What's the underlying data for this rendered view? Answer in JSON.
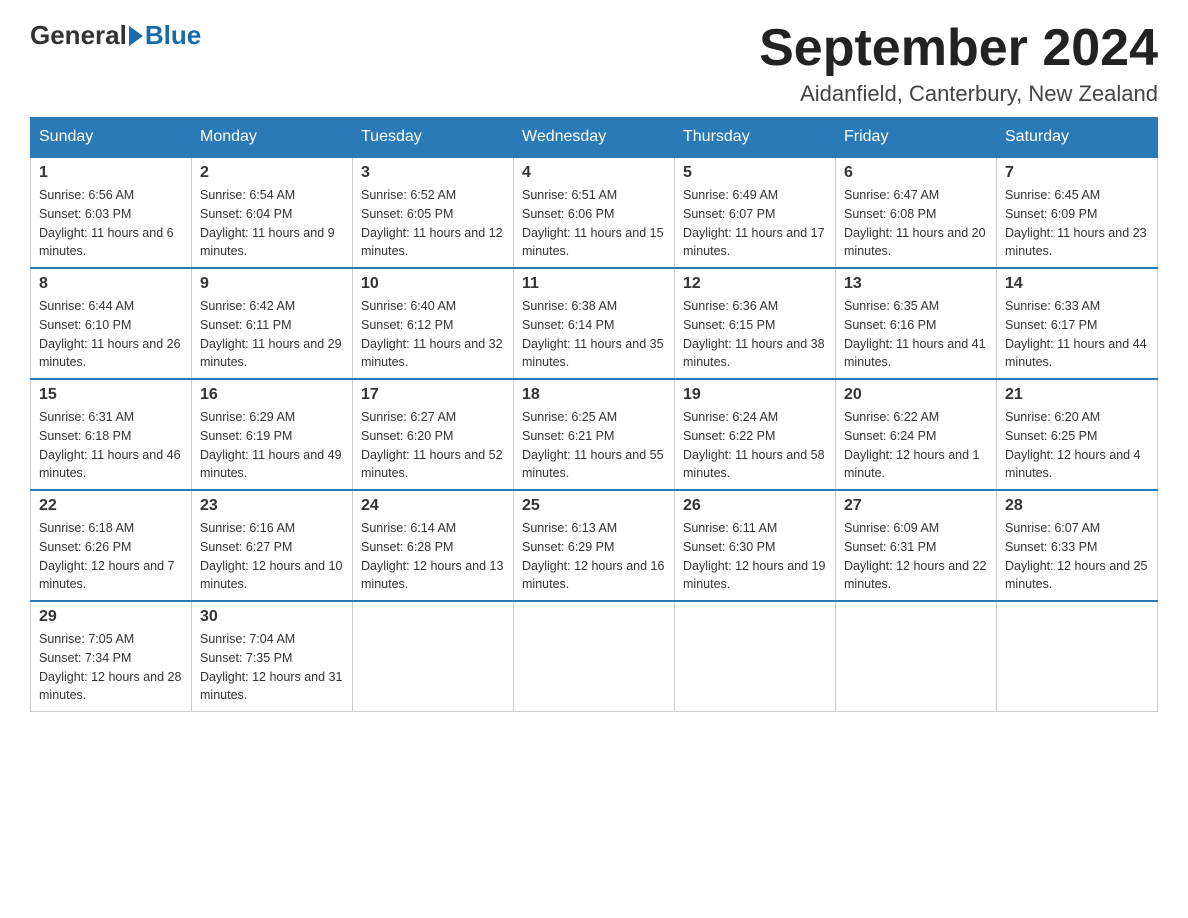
{
  "logo": {
    "general": "General",
    "blue": "Blue"
  },
  "title": "September 2024",
  "location": "Aidanfield, Canterbury, New Zealand",
  "days_of_week": [
    "Sunday",
    "Monday",
    "Tuesday",
    "Wednesday",
    "Thursday",
    "Friday",
    "Saturday"
  ],
  "weeks": [
    [
      {
        "day": "1",
        "sunrise": "Sunrise: 6:56 AM",
        "sunset": "Sunset: 6:03 PM",
        "daylight": "Daylight: 11 hours and 6 minutes."
      },
      {
        "day": "2",
        "sunrise": "Sunrise: 6:54 AM",
        "sunset": "Sunset: 6:04 PM",
        "daylight": "Daylight: 11 hours and 9 minutes."
      },
      {
        "day": "3",
        "sunrise": "Sunrise: 6:52 AM",
        "sunset": "Sunset: 6:05 PM",
        "daylight": "Daylight: 11 hours and 12 minutes."
      },
      {
        "day": "4",
        "sunrise": "Sunrise: 6:51 AM",
        "sunset": "Sunset: 6:06 PM",
        "daylight": "Daylight: 11 hours and 15 minutes."
      },
      {
        "day": "5",
        "sunrise": "Sunrise: 6:49 AM",
        "sunset": "Sunset: 6:07 PM",
        "daylight": "Daylight: 11 hours and 17 minutes."
      },
      {
        "day": "6",
        "sunrise": "Sunrise: 6:47 AM",
        "sunset": "Sunset: 6:08 PM",
        "daylight": "Daylight: 11 hours and 20 minutes."
      },
      {
        "day": "7",
        "sunrise": "Sunrise: 6:45 AM",
        "sunset": "Sunset: 6:09 PM",
        "daylight": "Daylight: 11 hours and 23 minutes."
      }
    ],
    [
      {
        "day": "8",
        "sunrise": "Sunrise: 6:44 AM",
        "sunset": "Sunset: 6:10 PM",
        "daylight": "Daylight: 11 hours and 26 minutes."
      },
      {
        "day": "9",
        "sunrise": "Sunrise: 6:42 AM",
        "sunset": "Sunset: 6:11 PM",
        "daylight": "Daylight: 11 hours and 29 minutes."
      },
      {
        "day": "10",
        "sunrise": "Sunrise: 6:40 AM",
        "sunset": "Sunset: 6:12 PM",
        "daylight": "Daylight: 11 hours and 32 minutes."
      },
      {
        "day": "11",
        "sunrise": "Sunrise: 6:38 AM",
        "sunset": "Sunset: 6:14 PM",
        "daylight": "Daylight: 11 hours and 35 minutes."
      },
      {
        "day": "12",
        "sunrise": "Sunrise: 6:36 AM",
        "sunset": "Sunset: 6:15 PM",
        "daylight": "Daylight: 11 hours and 38 minutes."
      },
      {
        "day": "13",
        "sunrise": "Sunrise: 6:35 AM",
        "sunset": "Sunset: 6:16 PM",
        "daylight": "Daylight: 11 hours and 41 minutes."
      },
      {
        "day": "14",
        "sunrise": "Sunrise: 6:33 AM",
        "sunset": "Sunset: 6:17 PM",
        "daylight": "Daylight: 11 hours and 44 minutes."
      }
    ],
    [
      {
        "day": "15",
        "sunrise": "Sunrise: 6:31 AM",
        "sunset": "Sunset: 6:18 PM",
        "daylight": "Daylight: 11 hours and 46 minutes."
      },
      {
        "day": "16",
        "sunrise": "Sunrise: 6:29 AM",
        "sunset": "Sunset: 6:19 PM",
        "daylight": "Daylight: 11 hours and 49 minutes."
      },
      {
        "day": "17",
        "sunrise": "Sunrise: 6:27 AM",
        "sunset": "Sunset: 6:20 PM",
        "daylight": "Daylight: 11 hours and 52 minutes."
      },
      {
        "day": "18",
        "sunrise": "Sunrise: 6:25 AM",
        "sunset": "Sunset: 6:21 PM",
        "daylight": "Daylight: 11 hours and 55 minutes."
      },
      {
        "day": "19",
        "sunrise": "Sunrise: 6:24 AM",
        "sunset": "Sunset: 6:22 PM",
        "daylight": "Daylight: 11 hours and 58 minutes."
      },
      {
        "day": "20",
        "sunrise": "Sunrise: 6:22 AM",
        "sunset": "Sunset: 6:24 PM",
        "daylight": "Daylight: 12 hours and 1 minute."
      },
      {
        "day": "21",
        "sunrise": "Sunrise: 6:20 AM",
        "sunset": "Sunset: 6:25 PM",
        "daylight": "Daylight: 12 hours and 4 minutes."
      }
    ],
    [
      {
        "day": "22",
        "sunrise": "Sunrise: 6:18 AM",
        "sunset": "Sunset: 6:26 PM",
        "daylight": "Daylight: 12 hours and 7 minutes."
      },
      {
        "day": "23",
        "sunrise": "Sunrise: 6:16 AM",
        "sunset": "Sunset: 6:27 PM",
        "daylight": "Daylight: 12 hours and 10 minutes."
      },
      {
        "day": "24",
        "sunrise": "Sunrise: 6:14 AM",
        "sunset": "Sunset: 6:28 PM",
        "daylight": "Daylight: 12 hours and 13 minutes."
      },
      {
        "day": "25",
        "sunrise": "Sunrise: 6:13 AM",
        "sunset": "Sunset: 6:29 PM",
        "daylight": "Daylight: 12 hours and 16 minutes."
      },
      {
        "day": "26",
        "sunrise": "Sunrise: 6:11 AM",
        "sunset": "Sunset: 6:30 PM",
        "daylight": "Daylight: 12 hours and 19 minutes."
      },
      {
        "day": "27",
        "sunrise": "Sunrise: 6:09 AM",
        "sunset": "Sunset: 6:31 PM",
        "daylight": "Daylight: 12 hours and 22 minutes."
      },
      {
        "day": "28",
        "sunrise": "Sunrise: 6:07 AM",
        "sunset": "Sunset: 6:33 PM",
        "daylight": "Daylight: 12 hours and 25 minutes."
      }
    ],
    [
      {
        "day": "29",
        "sunrise": "Sunrise: 7:05 AM",
        "sunset": "Sunset: 7:34 PM",
        "daylight": "Daylight: 12 hours and 28 minutes."
      },
      {
        "day": "30",
        "sunrise": "Sunrise: 7:04 AM",
        "sunset": "Sunset: 7:35 PM",
        "daylight": "Daylight: 12 hours and 31 minutes."
      },
      null,
      null,
      null,
      null,
      null
    ]
  ]
}
